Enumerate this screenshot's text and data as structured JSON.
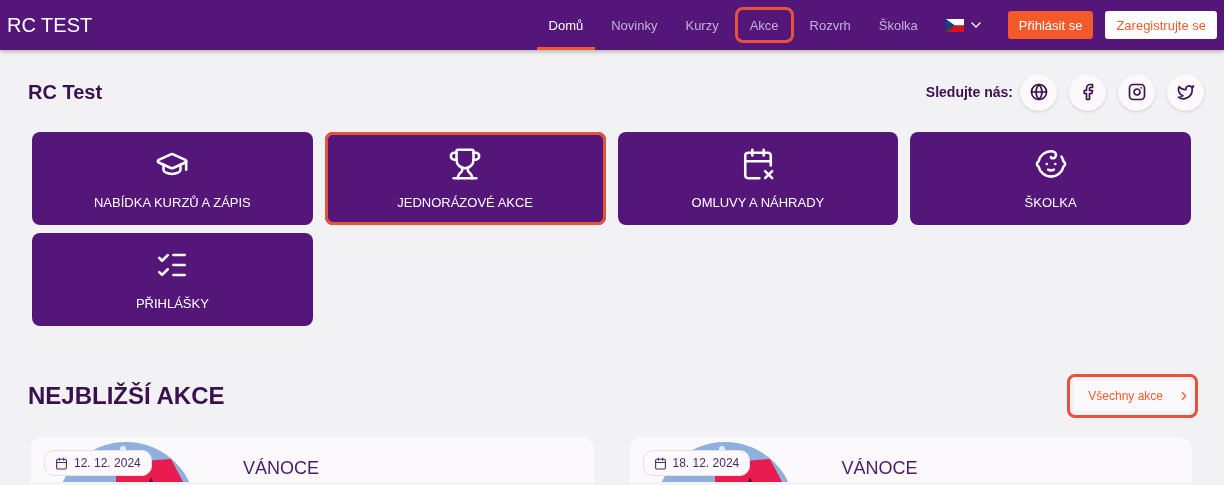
{
  "header": {
    "brand": "RC TEST",
    "nav": [
      {
        "label": "Domů",
        "selected": true,
        "highlighted": false
      },
      {
        "label": "Novinky",
        "selected": false,
        "highlighted": false
      },
      {
        "label": "Kurzy",
        "selected": false,
        "highlighted": false
      },
      {
        "label": "Akce",
        "selected": false,
        "highlighted": true
      },
      {
        "label": "Rozvrh",
        "selected": false,
        "highlighted": false
      },
      {
        "label": "Školka",
        "selected": false,
        "highlighted": false
      }
    ],
    "login_button": "Přihlásit se",
    "register_button": "Zaregistrujte se"
  },
  "page_title": "RC Test",
  "follow": {
    "label": "Sledujte nás:",
    "links": [
      {
        "kind": "web"
      },
      {
        "kind": "facebook"
      },
      {
        "kind": "instagram"
      },
      {
        "kind": "twitter"
      }
    ]
  },
  "tiles": [
    {
      "kind": "courses",
      "label": "NABÍDKA KURZŮ A ZÁPIS",
      "highlighted": false
    },
    {
      "kind": "events",
      "label": "JEDNORÁZOVÉ AKCE",
      "highlighted": true
    },
    {
      "kind": "excuses",
      "label": "OMLUVY A NÁHRADY",
      "highlighted": false
    },
    {
      "kind": "kindergarten",
      "label": "ŠKOLKA",
      "highlighted": false
    },
    {
      "kind": "registrations",
      "label": "PŘIHLÁŠKY",
      "highlighted": false
    }
  ],
  "upcoming": {
    "heading": "NEJBLIŽŠÍ AKCE",
    "all_button": {
      "label": "Všechny akce",
      "highlighted": true
    },
    "events": [
      {
        "date": "12. 12. 2024",
        "title": "VÁNOCE"
      },
      {
        "date": "18. 12. 2024",
        "title": "VÁNOCE"
      }
    ]
  }
}
